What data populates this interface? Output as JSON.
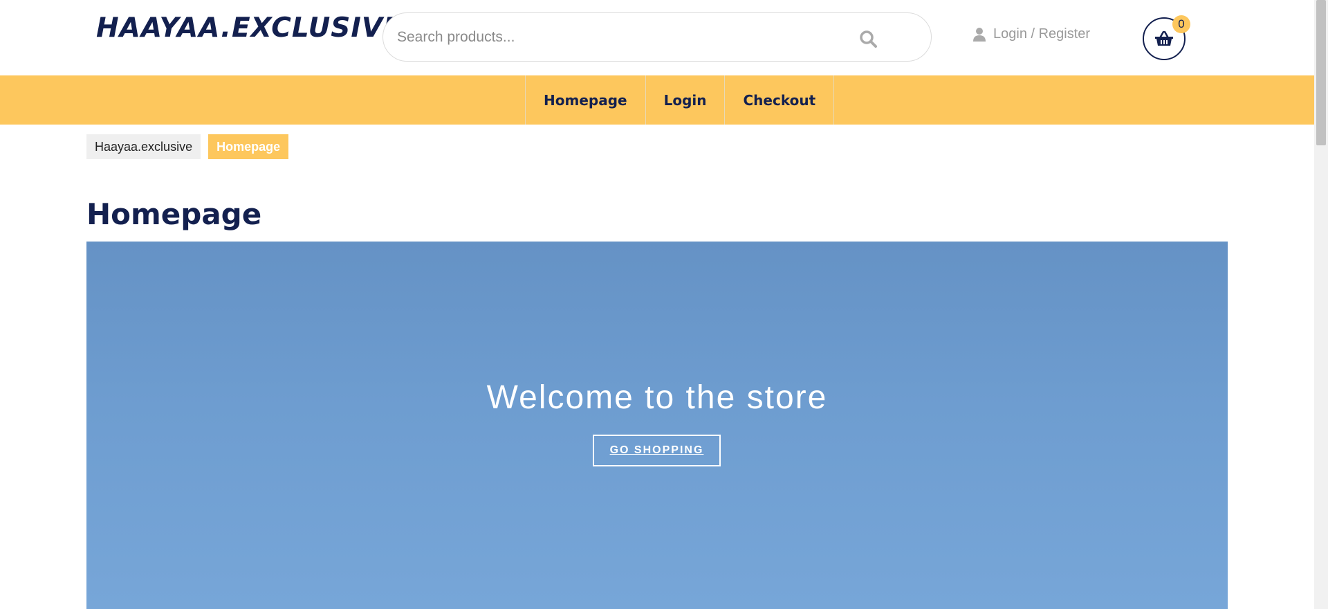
{
  "header": {
    "logo": "HAAYAA.EXCLUSIVE",
    "search_placeholder": "Search products...",
    "login_label": "Login / Register",
    "cart_count": "0"
  },
  "nav": {
    "items": [
      "Homepage",
      "Login",
      "Checkout"
    ]
  },
  "breadcrumb": {
    "home": "Haayaa.exclusive",
    "current": "Homepage"
  },
  "page": {
    "title": "Homepage"
  },
  "hero": {
    "title": "Welcome to the store",
    "button_label": "GO SHOPPING"
  },
  "colors": {
    "brand_navy": "#13204f",
    "accent_yellow": "#fdc75d",
    "hero_blue": "#6e9dd0"
  }
}
